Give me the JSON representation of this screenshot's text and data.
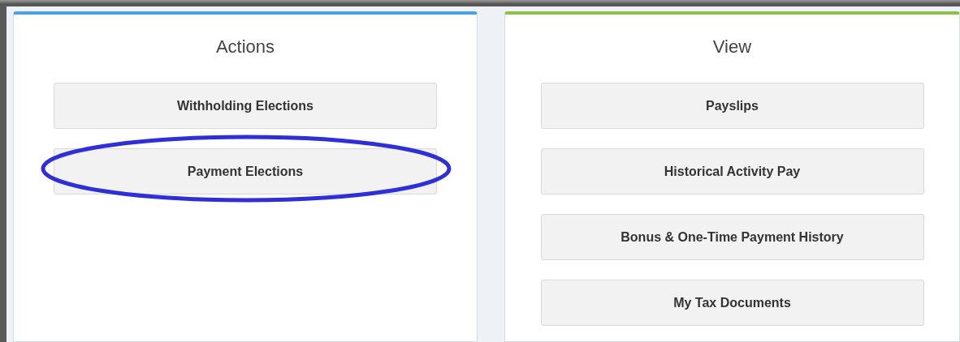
{
  "panels": [
    {
      "title": "Actions",
      "color": "#4aa3df",
      "buttons": [
        {
          "label": "Withholding Elections",
          "circled": false
        },
        {
          "label": "Payment Elections",
          "circled": true
        }
      ]
    },
    {
      "title": "View",
      "color": "#8dc04a",
      "buttons": [
        {
          "label": "Payslips",
          "circled": false
        },
        {
          "label": "Historical Activity Pay",
          "circled": false
        },
        {
          "label": "Bonus & One-Time Payment History",
          "circled": false
        },
        {
          "label": "My Tax Documents",
          "circled": false
        }
      ]
    }
  ]
}
